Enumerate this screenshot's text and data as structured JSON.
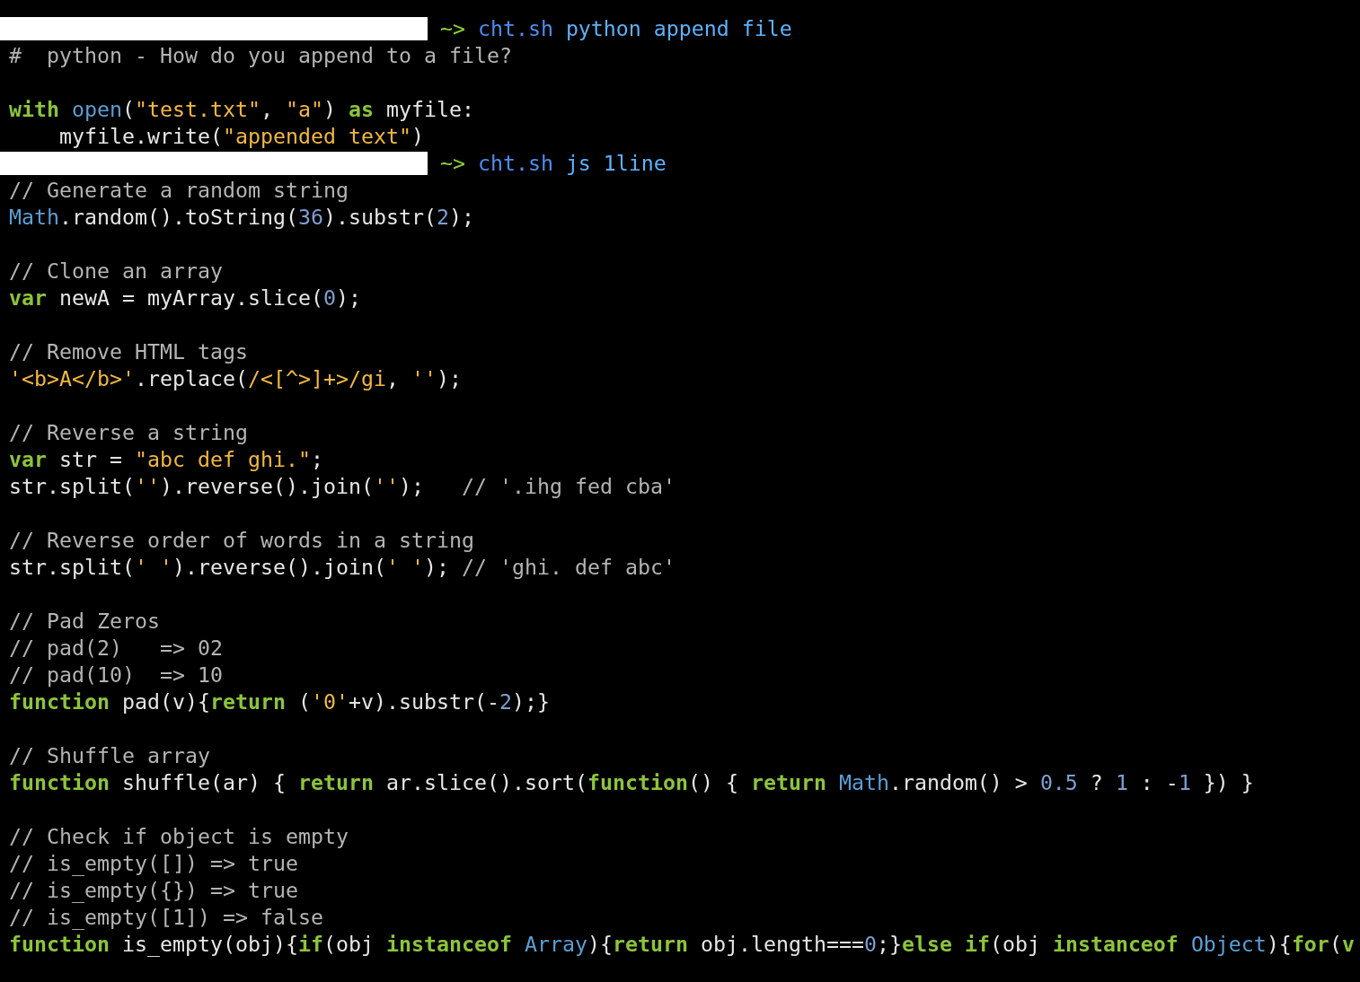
{
  "terminal": {
    "lines": [
      {
        "kind": "prompt",
        "tokens": [
          {
            "kind": "prompt",
            "text": "~> "
          },
          {
            "kind": "cmd",
            "text": "cht.sh "
          },
          {
            "kind": "arg",
            "text": "python append file"
          }
        ]
      },
      {
        "kind": "code",
        "tokens": [
          {
            "kind": "comment",
            "text": "#  python - How do you append to a file?"
          }
        ]
      },
      {
        "kind": "blank"
      },
      {
        "kind": "code",
        "tokens": [
          {
            "kind": "kw",
            "text": "with "
          },
          {
            "kind": "builtin",
            "text": "open"
          },
          {
            "kind": "plain",
            "text": "("
          },
          {
            "kind": "str",
            "text": "\"test.txt\""
          },
          {
            "kind": "plain",
            "text": ", "
          },
          {
            "kind": "str",
            "text": "\"a\""
          },
          {
            "kind": "plain",
            "text": ") "
          },
          {
            "kind": "kw",
            "text": "as"
          },
          {
            "kind": "plain",
            "text": " myfile:"
          }
        ]
      },
      {
        "kind": "code",
        "tokens": [
          {
            "kind": "plain",
            "text": "    myfile.write("
          },
          {
            "kind": "str",
            "text": "\"appended text\""
          },
          {
            "kind": "plain",
            "text": ")"
          }
        ]
      },
      {
        "kind": "prompt",
        "tokens": [
          {
            "kind": "prompt",
            "text": "~> "
          },
          {
            "kind": "cmd",
            "text": "cht.sh "
          },
          {
            "kind": "arg",
            "text": "js 1line"
          }
        ]
      },
      {
        "kind": "code",
        "tokens": [
          {
            "kind": "comment",
            "text": "// Generate a random string"
          }
        ]
      },
      {
        "kind": "code",
        "tokens": [
          {
            "kind": "builtin",
            "text": "Math"
          },
          {
            "kind": "plain",
            "text": ".random().toString("
          },
          {
            "kind": "num",
            "text": "36"
          },
          {
            "kind": "plain",
            "text": ").substr("
          },
          {
            "kind": "num",
            "text": "2"
          },
          {
            "kind": "plain",
            "text": ");"
          }
        ]
      },
      {
        "kind": "blank"
      },
      {
        "kind": "code",
        "tokens": [
          {
            "kind": "comment",
            "text": "// Clone an array"
          }
        ]
      },
      {
        "kind": "code",
        "tokens": [
          {
            "kind": "kw",
            "text": "var"
          },
          {
            "kind": "plain",
            "text": " newA = myArray.slice("
          },
          {
            "kind": "num",
            "text": "0"
          },
          {
            "kind": "plain",
            "text": ");"
          }
        ]
      },
      {
        "kind": "blank"
      },
      {
        "kind": "code",
        "tokens": [
          {
            "kind": "comment",
            "text": "// Remove HTML tags"
          }
        ]
      },
      {
        "kind": "code",
        "tokens": [
          {
            "kind": "str",
            "text": "'<b>A</b>'"
          },
          {
            "kind": "plain",
            "text": ".replace("
          },
          {
            "kind": "str",
            "text": "/<[^>]+>/gi"
          },
          {
            "kind": "plain",
            "text": ", "
          },
          {
            "kind": "str",
            "text": "''"
          },
          {
            "kind": "plain",
            "text": ");"
          }
        ]
      },
      {
        "kind": "blank"
      },
      {
        "kind": "code",
        "tokens": [
          {
            "kind": "comment",
            "text": "// Reverse a string"
          }
        ]
      },
      {
        "kind": "code",
        "tokens": [
          {
            "kind": "kw",
            "text": "var"
          },
          {
            "kind": "plain",
            "text": " str = "
          },
          {
            "kind": "str",
            "text": "\"abc def ghi.\""
          },
          {
            "kind": "plain",
            "text": ";"
          }
        ]
      },
      {
        "kind": "code",
        "tokens": [
          {
            "kind": "plain",
            "text": "str.split("
          },
          {
            "kind": "str",
            "text": "''"
          },
          {
            "kind": "plain",
            "text": ").reverse().join("
          },
          {
            "kind": "str",
            "text": "''"
          },
          {
            "kind": "plain",
            "text": ");   "
          },
          {
            "kind": "comment",
            "text": "// '.ihg fed cba'"
          }
        ]
      },
      {
        "kind": "blank"
      },
      {
        "kind": "code",
        "tokens": [
          {
            "kind": "comment",
            "text": "// Reverse order of words in a string"
          }
        ]
      },
      {
        "kind": "code",
        "tokens": [
          {
            "kind": "plain",
            "text": "str.split("
          },
          {
            "kind": "str",
            "text": "' '"
          },
          {
            "kind": "plain",
            "text": ").reverse().join("
          },
          {
            "kind": "str",
            "text": "' '"
          },
          {
            "kind": "plain",
            "text": "); "
          },
          {
            "kind": "comment",
            "text": "// 'ghi. def abc'"
          }
        ]
      },
      {
        "kind": "blank"
      },
      {
        "kind": "code",
        "tokens": [
          {
            "kind": "comment",
            "text": "// Pad Zeros"
          }
        ]
      },
      {
        "kind": "code",
        "tokens": [
          {
            "kind": "comment",
            "text": "// pad(2)   => 02"
          }
        ]
      },
      {
        "kind": "code",
        "tokens": [
          {
            "kind": "comment",
            "text": "// pad(10)  => 10"
          }
        ]
      },
      {
        "kind": "code",
        "tokens": [
          {
            "kind": "kw",
            "text": "function"
          },
          {
            "kind": "plain",
            "text": " pad(v){"
          },
          {
            "kind": "kw",
            "text": "return"
          },
          {
            "kind": "plain",
            "text": " ("
          },
          {
            "kind": "str",
            "text": "'0'"
          },
          {
            "kind": "plain",
            "text": "+v).substr(-"
          },
          {
            "kind": "num",
            "text": "2"
          },
          {
            "kind": "plain",
            "text": ");}"
          }
        ]
      },
      {
        "kind": "blank"
      },
      {
        "kind": "code",
        "tokens": [
          {
            "kind": "comment",
            "text": "// Shuffle array"
          }
        ]
      },
      {
        "kind": "code",
        "tokens": [
          {
            "kind": "kw",
            "text": "function"
          },
          {
            "kind": "plain",
            "text": " shuffle(ar) { "
          },
          {
            "kind": "kw",
            "text": "return"
          },
          {
            "kind": "plain",
            "text": " ar.slice().sort("
          },
          {
            "kind": "kw",
            "text": "function"
          },
          {
            "kind": "plain",
            "text": "() { "
          },
          {
            "kind": "kw",
            "text": "return "
          },
          {
            "kind": "builtin",
            "text": "Math"
          },
          {
            "kind": "plain",
            "text": ".random() > "
          },
          {
            "kind": "num",
            "text": "0.5"
          },
          {
            "kind": "plain",
            "text": " ? "
          },
          {
            "kind": "num",
            "text": "1"
          },
          {
            "kind": "plain",
            "text": " : -"
          },
          {
            "kind": "num",
            "text": "1"
          },
          {
            "kind": "plain",
            "text": " }) }"
          }
        ]
      },
      {
        "kind": "blank"
      },
      {
        "kind": "code",
        "tokens": [
          {
            "kind": "comment",
            "text": "// Check if object is empty"
          }
        ]
      },
      {
        "kind": "code",
        "tokens": [
          {
            "kind": "comment",
            "text": "// is_empty([]) => true"
          }
        ]
      },
      {
        "kind": "code",
        "tokens": [
          {
            "kind": "comment",
            "text": "// is_empty({}) => true"
          }
        ]
      },
      {
        "kind": "code",
        "tokens": [
          {
            "kind": "comment",
            "text": "// is_empty([1]) => false"
          }
        ]
      },
      {
        "kind": "code",
        "tokens": [
          {
            "kind": "kw",
            "text": "function"
          },
          {
            "kind": "plain",
            "text": " is_empty(obj){"
          },
          {
            "kind": "kw",
            "text": "if"
          },
          {
            "kind": "plain",
            "text": "(obj "
          },
          {
            "kind": "kw",
            "text": "instanceof "
          },
          {
            "kind": "builtin",
            "text": "Array"
          },
          {
            "kind": "plain",
            "text": "){"
          },
          {
            "kind": "kw",
            "text": "return"
          },
          {
            "kind": "plain",
            "text": " obj.length==="
          },
          {
            "kind": "num",
            "text": "0"
          },
          {
            "kind": "plain",
            "text": ";}"
          },
          {
            "kind": "kw",
            "text": "else if"
          },
          {
            "kind": "plain",
            "text": "(obj "
          },
          {
            "kind": "kw",
            "text": "instanceof "
          },
          {
            "kind": "builtin",
            "text": "Object"
          },
          {
            "kind": "plain",
            "text": "){"
          },
          {
            "kind": "kw",
            "text": "for"
          },
          {
            "kind": "plain",
            "text": "("
          },
          {
            "kind": "kw",
            "text": "v"
          }
        ]
      }
    ]
  }
}
